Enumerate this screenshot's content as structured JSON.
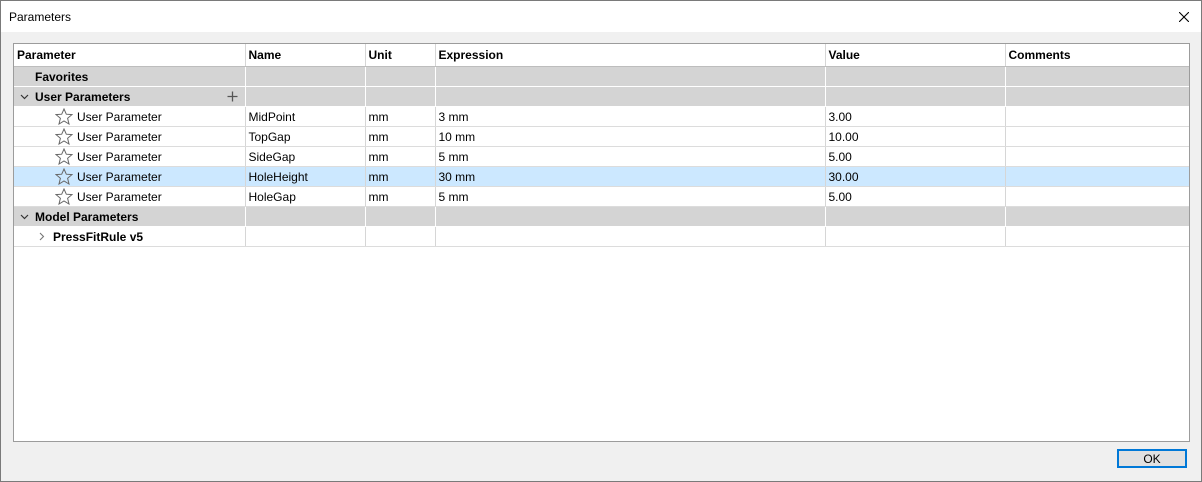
{
  "window": {
    "title": "Parameters"
  },
  "columns": {
    "parameter": "Parameter",
    "name": "Name",
    "unit": "Unit",
    "expression": "Expression",
    "value": "Value",
    "comments": "Comments"
  },
  "groups": {
    "favorites": "Favorites",
    "user_parameters": "User Parameters",
    "model_parameters": "Model Parameters",
    "model_child": "PressFitRule v5"
  },
  "rows": [
    {
      "parameter": "User Parameter",
      "name": "MidPoint",
      "unit": "mm",
      "expression": "3 mm",
      "value": "3.00",
      "comments": ""
    },
    {
      "parameter": "User Parameter",
      "name": "TopGap",
      "unit": "mm",
      "expression": "10 mm",
      "value": "10.00",
      "comments": ""
    },
    {
      "parameter": "User Parameter",
      "name": "SideGap",
      "unit": "mm",
      "expression": "5 mm",
      "value": "5.00",
      "comments": ""
    },
    {
      "parameter": "User Parameter",
      "name": "HoleHeight",
      "unit": "mm",
      "expression": "30 mm",
      "value": "30.00",
      "comments": ""
    },
    {
      "parameter": "User Parameter",
      "name": "HoleGap",
      "unit": "mm",
      "expression": "5 mm",
      "value": "5.00",
      "comments": ""
    }
  ],
  "selected_row": "HoleHeight",
  "footer": {
    "ok_label": "OK"
  },
  "colors": {
    "selection": "#cce8ff",
    "group_band": "#d4d4d4",
    "ok_border": "#0078d7"
  }
}
